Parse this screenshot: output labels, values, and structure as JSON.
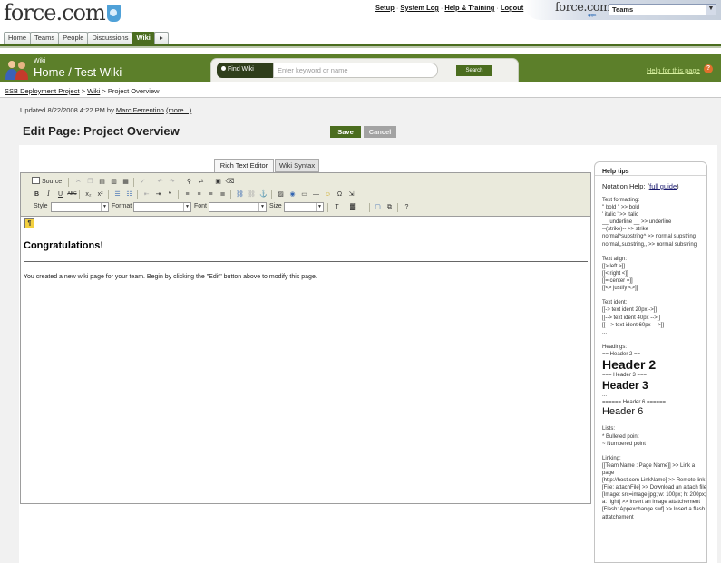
{
  "header": {
    "logo_text": "force.com",
    "top_links": [
      "Setup",
      "System Log",
      "Help & Training",
      "Logout"
    ],
    "apps_logo": "force.com",
    "apps_sub": "apps",
    "app_selector": "Teams"
  },
  "tabs": [
    {
      "label": "Home",
      "active": false
    },
    {
      "label": "Teams",
      "active": false
    },
    {
      "label": "People",
      "active": false
    },
    {
      "label": "Discussions",
      "active": false
    },
    {
      "label": "Wiki",
      "active": true
    },
    {
      "label": "▸",
      "active": false
    }
  ],
  "banner": {
    "section": "Wiki",
    "title": "Home / Test Wiki",
    "find_label": "Find Wiki",
    "search_placeholder": "Enter keyword or name",
    "search_button": "Search",
    "help_link": "Help for this page",
    "help_icon": "?"
  },
  "breadcrumb": {
    "items": [
      "SSB Deployment Project",
      "Wiki"
    ],
    "current": "Project Overview",
    "separator": ">"
  },
  "page": {
    "updated_prefix": "Updated 8/22/2008 4:22 PM by",
    "updated_user": "Marc Ferrentino",
    "more_link": "(more...)",
    "title": "Edit Page: Project Overview",
    "save_label": "Save",
    "cancel_label": "Cancel"
  },
  "editor": {
    "tab_rte": "Rich Text Editor",
    "tab_wiki": "Wiki Syntax",
    "source_label": "Source",
    "style_label": "Style",
    "format_label": "Format",
    "font_label": "Font",
    "size_label": "Size",
    "anchor_glyph": "¶",
    "heading": "Congratulations!",
    "body": "You created a new wiki page for your team. Begin by clicking the \"Edit\" button above to modify this page."
  },
  "help": {
    "title": "Help tips",
    "notation_prefix": "Notation Help: (",
    "notation_link": "full guide",
    "notation_suffix": ")",
    "lines": [
      {
        "text": "Text formatting:",
        "style": "line"
      },
      {
        "text": "'' bold '' >> bold",
        "style": "line"
      },
      {
        "text": "' italic ' >> italic",
        "style": "line"
      },
      {
        "text": "__ underline __ >> underline",
        "style": "line"
      },
      {
        "text": "--(strike)-- >> strike",
        "style": "line"
      },
      {
        "text": "normal^supstring^ >> normal supstring",
        "style": "line"
      },
      {
        "text": "normal,,substring,, >> normal substring",
        "style": "line"
      },
      {
        "text": "",
        "style": "gap"
      },
      {
        "text": "Text align:",
        "style": "line"
      },
      {
        "text": "[[> left >]]",
        "style": "line"
      },
      {
        "text": "[[< right <]]",
        "style": "line"
      },
      {
        "text": "[[= center =]]",
        "style": "line"
      },
      {
        "text": "[[<> justify <>]]",
        "style": "line"
      },
      {
        "text": "",
        "style": "gap"
      },
      {
        "text": "Text ident:",
        "style": "line"
      },
      {
        "text": "[[-> text ident 20px ->]]",
        "style": "line"
      },
      {
        "text": "[[--> text ident 40px -->]]",
        "style": "line"
      },
      {
        "text": "[[---> text ident 60px --->]]",
        "style": "line"
      },
      {
        "text": "...",
        "style": "line"
      },
      {
        "text": "",
        "style": "gap"
      },
      {
        "text": "Headings:",
        "style": "line"
      },
      {
        "text": "== Header 2 ==",
        "style": "line"
      },
      {
        "text": "Header 2",
        "style": "h2"
      },
      {
        "text": "=== Header 3 ===",
        "style": "line"
      },
      {
        "text": "Header 3",
        "style": "h3"
      },
      {
        "text": "...",
        "style": "line"
      },
      {
        "text": "====== Header 6 ======",
        "style": "line"
      },
      {
        "text": "Header 6",
        "style": "h6"
      },
      {
        "text": "",
        "style": "gap"
      },
      {
        "text": "Lists:",
        "style": "line"
      },
      {
        "text": "* Bulleted point",
        "style": "line"
      },
      {
        "text": "~ Numbered point",
        "style": "line"
      },
      {
        "text": "",
        "style": "gap"
      },
      {
        "text": "Linking:",
        "style": "line"
      },
      {
        "text": "[[Team Name : Page Name]] >> Link a page",
        "style": "wrap"
      },
      {
        "text": "[http://host.com LinkName] >> Remote link",
        "style": "wrap"
      },
      {
        "text": "[File: attachFile] >> Download an attach file",
        "style": "wrap"
      },
      {
        "text": "[Image: src=image.jpg; w: 100px; h: 200px; a: right] >> Insert an image attatchement",
        "style": "wrap"
      },
      {
        "text": "[Flash: Appexchange.swf] >> Insert a flash attatchement",
        "style": "wrap"
      }
    ]
  },
  "colors": {
    "brand_green": "#4b6d1f",
    "banner_green": "#5c7f2a",
    "link_blue": "#1a1a6e",
    "help_orange": "#e0702c"
  }
}
